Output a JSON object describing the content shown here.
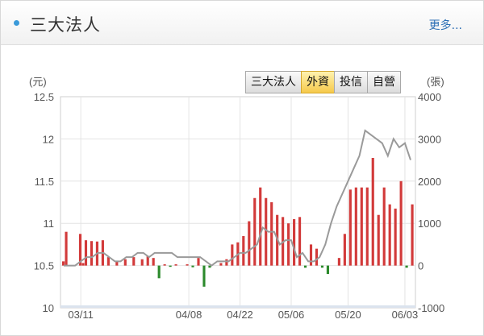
{
  "header": {
    "title": "三大法人",
    "more_label": "更多..."
  },
  "tabs": [
    {
      "label": "三大法人",
      "active": false
    },
    {
      "label": "外資",
      "active": true
    },
    {
      "label": "投信",
      "active": false
    },
    {
      "label": "自營",
      "active": false
    }
  ],
  "colors": {
    "bar_positive": "#d23a3a",
    "bar_negative": "#2c8a2c",
    "price_line": "#9a9a9a",
    "active_tab": "#f6c94a",
    "accent": "#3b9ad9"
  },
  "chart_data": {
    "type": "bar",
    "y_left": {
      "unit": "(元)",
      "ticks": [
        "12.5",
        "12",
        "11.5",
        "11",
        "10.5",
        "10"
      ],
      "range": [
        10,
        12.5
      ]
    },
    "y_right": {
      "unit": "(張)",
      "ticks": [
        "4000",
        "3000",
        "2000",
        "1000",
        "0",
        "-1000"
      ],
      "range": [
        -1000,
        4000
      ]
    },
    "x_ticks": [
      {
        "label": "03/11",
        "index": 3
      },
      {
        "label": "04/08",
        "index": 22
      },
      {
        "label": "04/22",
        "index": 31
      },
      {
        "label": "05/06",
        "index": 40
      },
      {
        "label": "05/20",
        "index": 50
      },
      {
        "label": "06/03",
        "index": 60
      }
    ],
    "series": [
      {
        "kind": "bar",
        "values": [
          100,
          800,
          0,
          0,
          0,
          0,
          750,
          60,
          600,
          0,
          580,
          0,
          570,
          0,
          600,
          0,
          200,
          0,
          0,
          100,
          0,
          0,
          150,
          0,
          0,
          200,
          0,
          0,
          150,
          0,
          230,
          0,
          180,
          0,
          -300,
          0,
          30,
          0,
          -30,
          0,
          30,
          0,
          0,
          0,
          30,
          0,
          -40,
          0,
          180,
          0,
          -500,
          0,
          -50,
          0,
          0,
          0,
          60,
          0,
          150,
          0,
          500,
          0,
          550,
          0,
          700,
          0,
          1050,
          0,
          1600,
          0,
          1850,
          0,
          1600,
          0,
          1500,
          0,
          1200,
          0,
          1150,
          0,
          1000,
          0,
          1100,
          0,
          1150,
          0,
          -50,
          0,
          500,
          0,
          400,
          0,
          -50,
          0,
          -200,
          0,
          0,
          0,
          180,
          0,
          750,
          0,
          1800,
          0,
          1850,
          0,
          1850,
          0,
          1850,
          0,
          2550,
          0,
          1200,
          0,
          1850,
          0,
          1450,
          0,
          1350,
          0,
          2000,
          0,
          -50,
          0,
          1450
        ]
      },
      {
        "kind": "line",
        "values": [
          10.5,
          10.5,
          10.5,
          10.55,
          10.6,
          10.6,
          10.65,
          10.65,
          10.6,
          10.55,
          10.55,
          10.6,
          10.6,
          10.65,
          10.65,
          10.6,
          10.65,
          10.65,
          10.65,
          10.65,
          10.6,
          10.6,
          10.6,
          10.6,
          10.6,
          10.55,
          10.5,
          10.55,
          10.55,
          10.55,
          10.6,
          10.65,
          10.65,
          10.7,
          10.75,
          10.95,
          10.9,
          10.9,
          10.75,
          10.8,
          10.8,
          10.6,
          10.65,
          10.55,
          10.55,
          10.6,
          10.75,
          11.0,
          11.2,
          11.35,
          11.5,
          11.65,
          11.8,
          12.1,
          12.05,
          12.0,
          11.95,
          11.8,
          12.0,
          11.9,
          11.95,
          11.75
        ]
      }
    ]
  }
}
